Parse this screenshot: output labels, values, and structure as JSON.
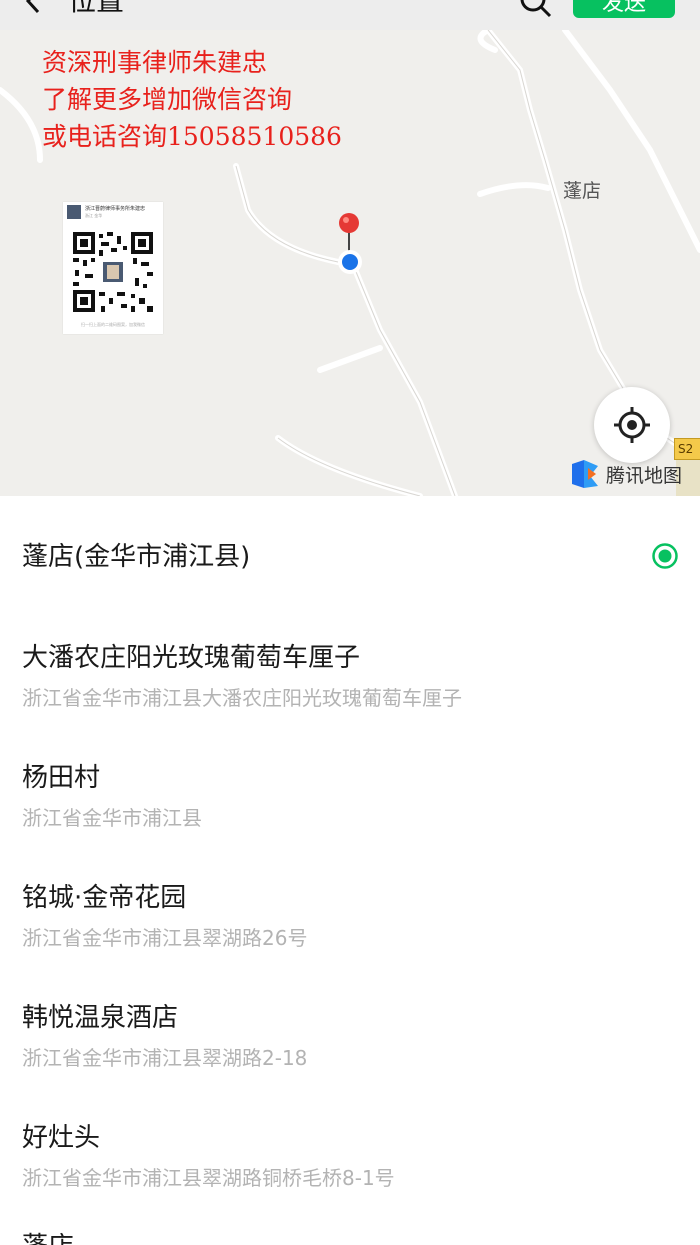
{
  "topbar": {
    "title": "位置",
    "send_label": "发送"
  },
  "map": {
    "watermark_lines": [
      "资深刑事律师朱建忠",
      "了解更多增加微信咨询",
      "或电话咨询15058510586"
    ],
    "place_label": "蓬店",
    "road_shield": "S2",
    "provider_label": "腾讯地图",
    "qr_card": {
      "name": "浙江晋蔚律师事务所朱建忠",
      "region": "浙江 金华",
      "caption": "扫一扫上面的二维码图案，加我微信"
    }
  },
  "locations": [
    {
      "name": "蓬店(金华市浦江县)",
      "address": "",
      "selected": true
    },
    {
      "name": "大潘农庄阳光玫瑰葡萄车厘子",
      "address": "浙江省金华市浦江县大潘农庄阳光玫瑰葡萄车厘子",
      "selected": false
    },
    {
      "name": "杨田村",
      "address": "浙江省金华市浦江县",
      "selected": false
    },
    {
      "name": "铭城·金帝花园",
      "address": "浙江省金华市浦江县翠湖路26号",
      "selected": false
    },
    {
      "name": "韩悦温泉酒店",
      "address": "浙江省金华市浦江县翠湖路2-18",
      "selected": false
    },
    {
      "name": "好灶头",
      "address": "浙江省金华市浦江县翠湖路铜桥毛桥8-1号",
      "selected": false
    },
    {
      "name": "蓬店",
      "address": "",
      "selected": false
    }
  ],
  "colors": {
    "accent": "#07c160",
    "watermark": "#e8211c",
    "pin": "#e53935",
    "location_dot": "#1a73e8"
  }
}
